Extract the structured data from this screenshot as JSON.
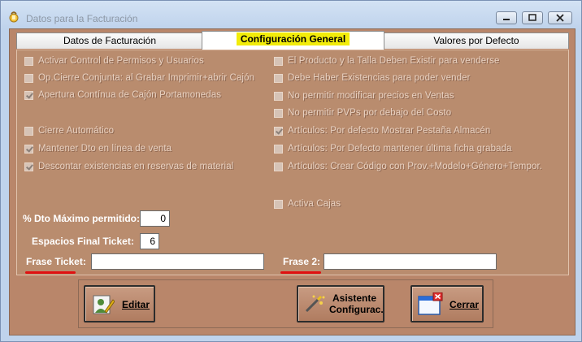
{
  "window": {
    "title": "Datos para la Facturación"
  },
  "tabs": [
    {
      "label": "Datos de Facturación"
    },
    {
      "label": "Configuración General"
    },
    {
      "label": "Valores por Defecto"
    }
  ],
  "options_left": [
    {
      "label": "Activar Control de Permisos y Usuarios",
      "checked": false
    },
    {
      "label": "Op.Cierre Conjunta: al Grabar Imprimir+abrir Cajón",
      "checked": false
    },
    {
      "label": "Apertura Contínua de Cajón Portamonedas",
      "checked": true
    },
    {
      "label": "Cierre Automático",
      "checked": false
    },
    {
      "label": "Mantener Dto en línea de venta",
      "checked": true
    },
    {
      "label": "Descontar existencias en reservas de material",
      "checked": true
    }
  ],
  "options_right": [
    {
      "label": "El Producto y la Talla Deben Existir para venderse",
      "checked": false
    },
    {
      "label": "Debe Haber Existencias para poder vender",
      "checked": false
    },
    {
      "label": "No permitir modificar precios en Ventas",
      "checked": false
    },
    {
      "label": "No permitir PVPs por debajo del Costo",
      "checked": false
    },
    {
      "label": "Artículos: Por defecto Mostrar Pestaña Almacén",
      "checked": true
    },
    {
      "label": "Artículos: Por Defecto mantener última ficha grabada",
      "checked": false
    },
    {
      "label": "Artículos: Crear Código con Prov.+Modelo+Género+Tempor.",
      "checked": false
    },
    {
      "label": "Activa Cajas",
      "checked": false
    }
  ],
  "fields": {
    "dto_max_label": "% Dto Máximo permitido:",
    "dto_max_value": "0",
    "espacios_label": "Espacios Final Ticket:",
    "espacios_value": "6",
    "frase_ticket_label": "Frase Ticket:",
    "frase_ticket_value": "",
    "frase2_label": "Frase 2:",
    "frase2_value": ""
  },
  "buttons": {
    "editar": "Editar",
    "asistente_line1": "Asistente",
    "asistente_line2": "Configurac.",
    "cerrar": "Cerrar"
  },
  "colors": {
    "highlight": "#f2ec0a",
    "underline": "#e01010",
    "panel": "#b98c6e"
  }
}
